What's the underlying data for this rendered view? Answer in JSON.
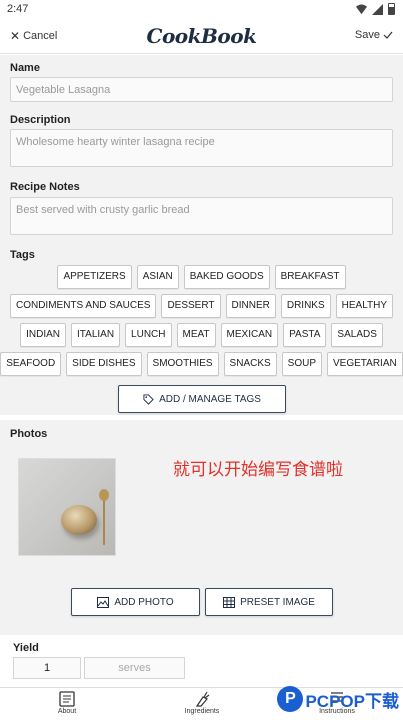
{
  "status_bar": {
    "time": "2:47",
    "wifi_icon": "wifi-icon",
    "battery_icon": "battery-icon"
  },
  "header": {
    "cancel_label": "Cancel",
    "logo": "CookBook",
    "save_label": "Save"
  },
  "form": {
    "name": {
      "label": "Name",
      "value": "Vegetable Lasagna"
    },
    "description": {
      "label": "Description",
      "value": "Wholesome hearty winter lasagna recipe"
    },
    "notes": {
      "label": "Recipe Notes",
      "value": "Best served with crusty garlic bread"
    }
  },
  "tags": {
    "label": "Tags",
    "rows": [
      [
        "APPETIZERS",
        "ASIAN",
        "BAKED GOODS",
        "BREAKFAST"
      ],
      [
        "CONDIMENTS AND SAUCES",
        "DESSERT",
        "DINNER",
        "DRINKS",
        "HEALTHY"
      ],
      [
        "INDIAN",
        "ITALIAN",
        "LUNCH",
        "MEAT",
        "MEXICAN",
        "PASTA",
        "SALADS"
      ],
      [
        "SEAFOOD",
        "SIDE DISHES",
        "SMOOTHIES",
        "SNACKS",
        "SOUP",
        "VEGETARIAN"
      ]
    ],
    "manage_label": "ADD / MANAGE TAGS"
  },
  "photos": {
    "label": "Photos",
    "overlay_text": "就可以开始编写食谱啦",
    "add_photo_label": "ADD PHOTO",
    "preset_image_label": "PRESET IMAGE"
  },
  "yield": {
    "label": "Yield",
    "value": "1",
    "unit": "serves"
  },
  "bottom_nav": {
    "about": "About",
    "ingredients": "Ingredients",
    "instructions": "Instructions"
  },
  "watermark": {
    "mark": "P",
    "text": "PCPOP下载"
  }
}
